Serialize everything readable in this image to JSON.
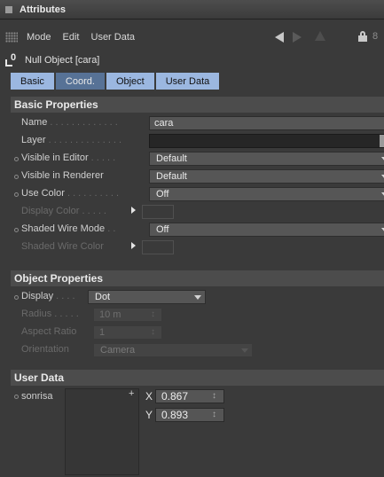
{
  "window": {
    "title": "Attributes"
  },
  "menubar": {
    "items": [
      "Mode",
      "Edit",
      "User Data"
    ]
  },
  "object": {
    "name": "Null Object [cara]"
  },
  "tabs": [
    {
      "label": "Basic",
      "active": true
    },
    {
      "label": "Coord.",
      "active": false
    },
    {
      "label": "Object",
      "active": true
    },
    {
      "label": "User Data",
      "active": true
    }
  ],
  "basic": {
    "header": "Basic Properties",
    "name_label": "Name",
    "name_dots": " . . . . . . . . . . . . .",
    "name_value": "cara",
    "layer_label": "Layer",
    "layer_dots": " . . . . . . . . . . . . . .",
    "vis_editor_label": "Visible in Editor",
    "vis_editor_dots": " . . . . .",
    "vis_editor_value": "Default",
    "vis_render_label": "Visible in Renderer",
    "vis_render_value": "Default",
    "use_color_label": "Use Color",
    "use_color_dots": " . . . . . . . . . .",
    "use_color_value": "Off",
    "display_color_label": "Display Color",
    "display_color_dots": " . . . . .",
    "shaded_wire_label": "Shaded Wire Mode",
    "shaded_wire_dots": " . .",
    "shaded_wire_value": "Off",
    "shaded_wire_color_label": "Shaded Wire Color"
  },
  "object_props": {
    "header": "Object Properties",
    "display_label": "Display",
    "display_dots": " . . . .",
    "display_value": "Dot",
    "radius_label": "Radius",
    "radius_dots": " . . . . .",
    "radius_value": "10 m",
    "aspect_label": "Aspect Ratio",
    "aspect_value": "1",
    "orientation_label": "Orientation",
    "orientation_value": "Camera"
  },
  "user_data": {
    "header": "User Data",
    "field_label": "sonrisa",
    "x_label": "X",
    "x_value": "0.867",
    "y_label": "Y",
    "y_value": "0.893"
  },
  "icons": [
    "window-icon",
    "grip-icon",
    "nav-left-icon",
    "nav-right-icon",
    "nav-up-icon",
    "lock-icon",
    "pin-icon",
    "null-object-icon"
  ]
}
